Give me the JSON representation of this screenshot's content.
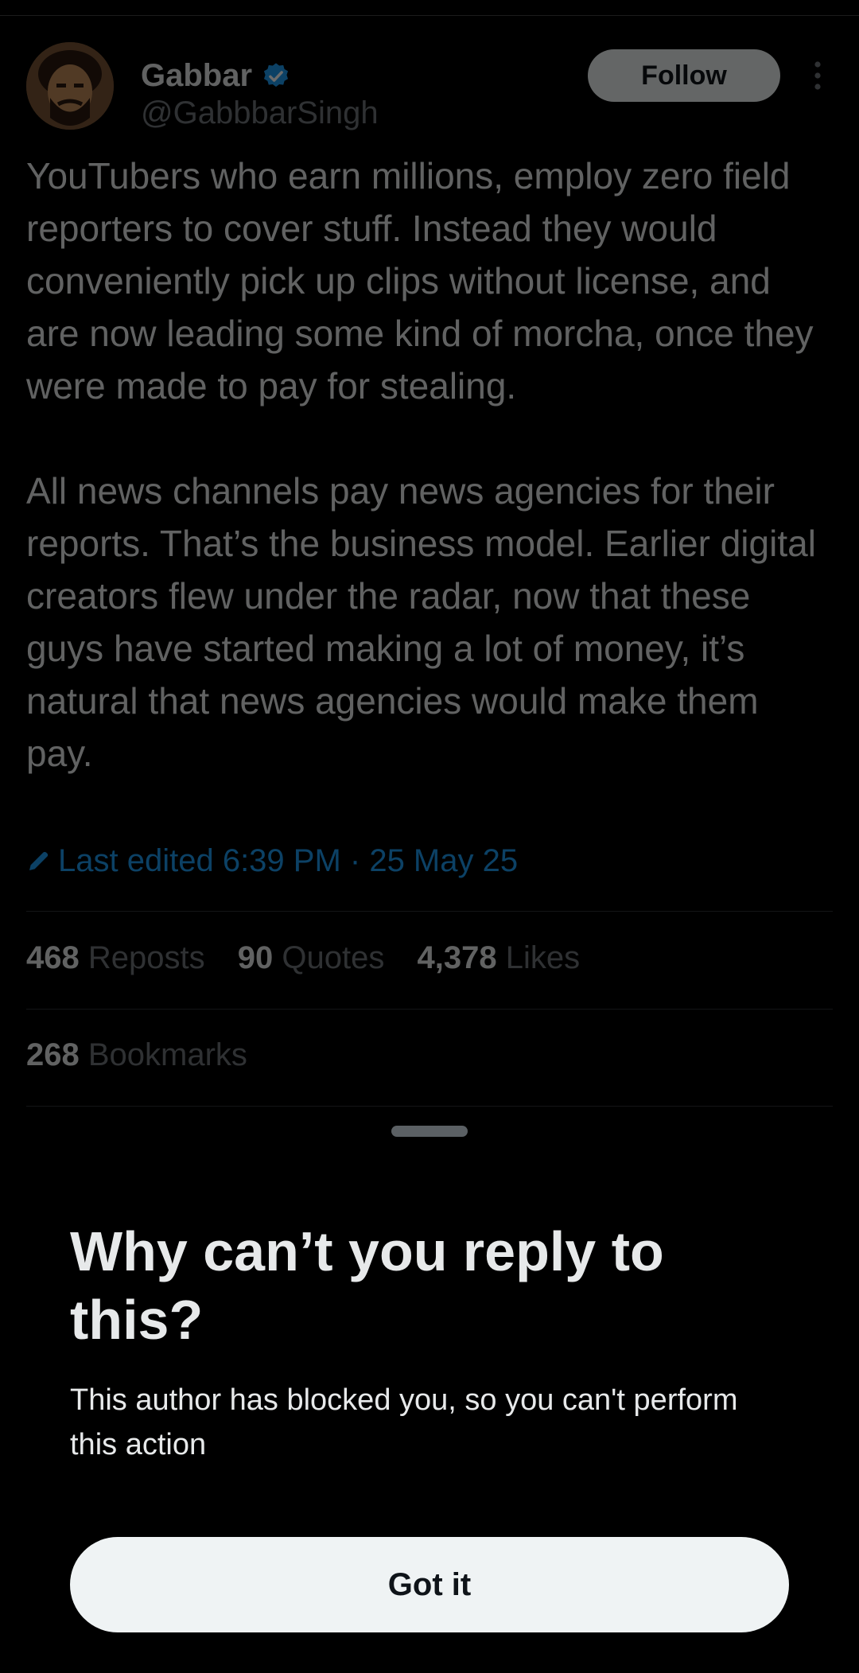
{
  "tweet": {
    "author": {
      "display_name": "Gabbar",
      "handle": "@GabbbarSingh",
      "verified": true,
      "avatar_icon": "avatar-illustrated-portrait"
    },
    "follow_label": "Follow",
    "more_icon": "more-vertical-icon",
    "paragraphs": [
      "YouTubers who earn millions, employ zero field reporters to cover stuff. Instead they would conveniently pick up clips without license, and are now leading some kind of morcha, once they were made to pay for stealing.",
      "All news channels pay news agencies for their reports. That’s the business model. Earlier digital creators flew under the radar, now that these guys have started making a lot of money, it’s natural that news agencies would make them pay."
    ],
    "edited_text": "Last edited 6:39 PM · 25 May 25",
    "edit_icon": "pencil-icon",
    "stats": {
      "reposts": {
        "count": "468",
        "label": "Reposts"
      },
      "quotes": {
        "count": "90",
        "label": "Quotes"
      },
      "likes": {
        "count": "4,378",
        "label": "Likes"
      },
      "bookmarks": {
        "count": "268",
        "label": "Bookmarks"
      }
    }
  },
  "sheet": {
    "title": "Why can’t you reply to this?",
    "description": "This author has blocked you, so you can't perform this action",
    "button_label": "Got it"
  },
  "colors": {
    "background": "#000000",
    "accent": "#1d9bf0",
    "text_primary": "#e7e9ea",
    "text_secondary": "#71767b",
    "button_bg": "#eff3f4"
  }
}
